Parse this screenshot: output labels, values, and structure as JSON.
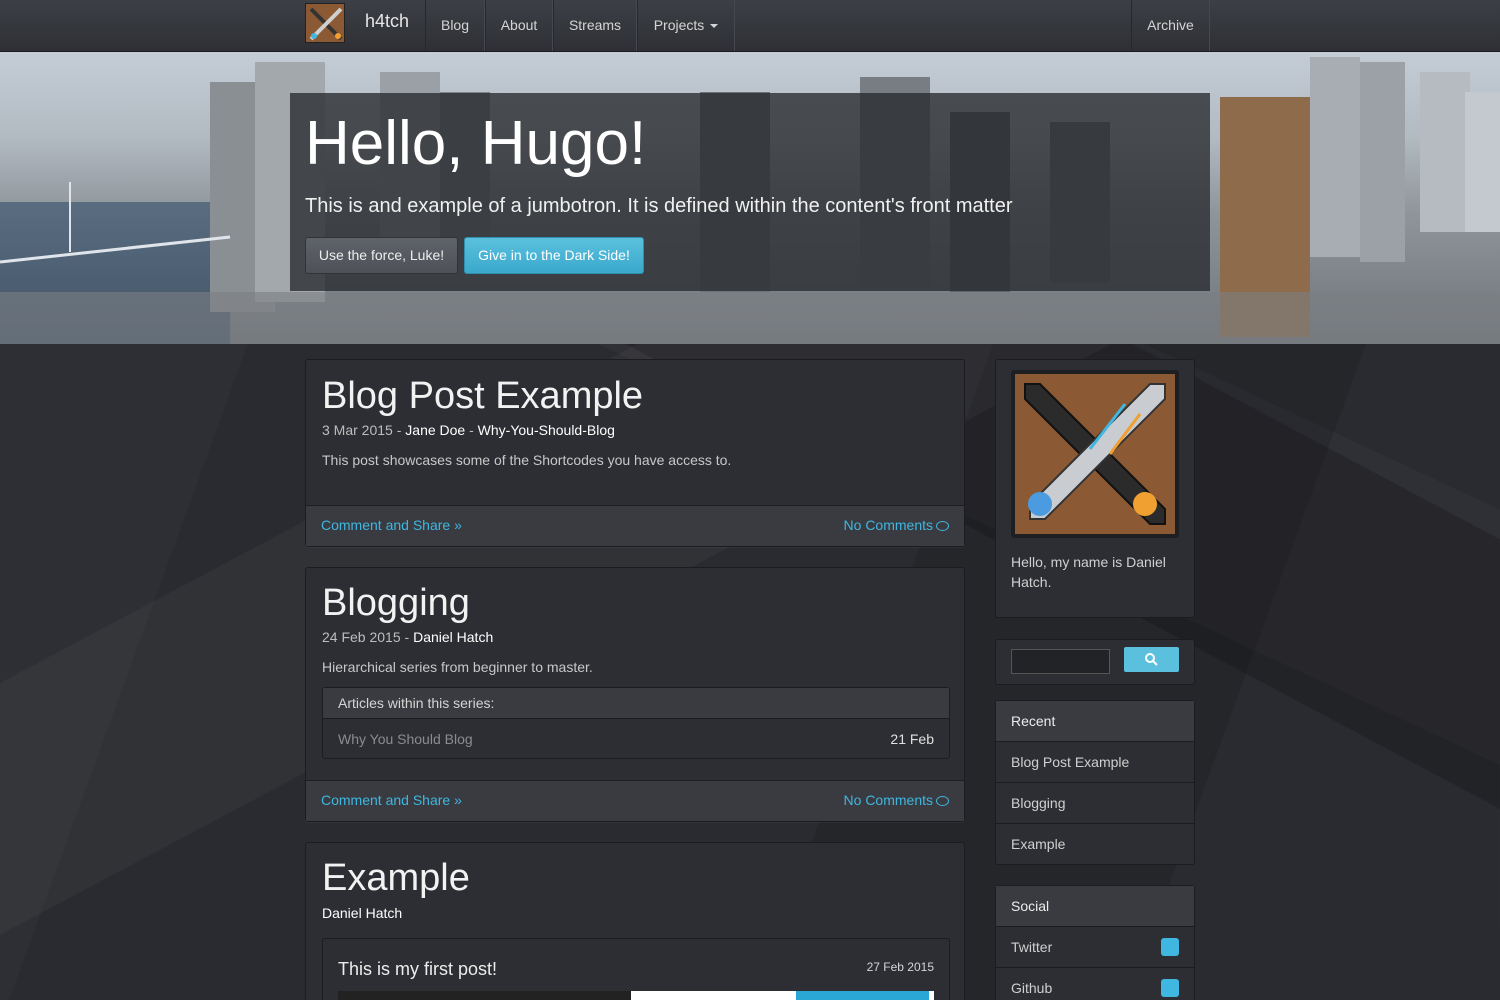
{
  "nav": {
    "brand": "h4tch",
    "items": [
      "Blog",
      "About",
      "Streams",
      "Projects"
    ],
    "right_item": "Archive"
  },
  "jumbotron": {
    "title": "Hello, Hugo!",
    "subtitle": "This is and example of a jumbotron. It is defined within the content's front matter",
    "button1": "Use the force, Luke!",
    "button2": "Give in to the Dark Side!"
  },
  "posts": [
    {
      "title": "Blog Post Example",
      "date": "3 Mar 2015",
      "author": "Jane Doe",
      "series": "Why-You-Should-Blog",
      "description": "This post showcases some of the Shortcodes you have access to.",
      "comment_link": "Comment and Share »",
      "comments": "No Comments"
    },
    {
      "title": "Blogging",
      "date": "24 Feb 2015",
      "author": "Daniel Hatch",
      "description": "Hierarchical series from beginner to master.",
      "series_box": {
        "header": "Articles within this series:",
        "item": "Why You Should Blog",
        "item_date": "21 Feb"
      },
      "comment_link": "Comment and Share »",
      "comments": "No Comments"
    },
    {
      "title": "Example",
      "author": "Daniel Hatch",
      "inner": {
        "title": "This is my first post!",
        "date": "27 Feb 2015"
      }
    }
  ],
  "sidebar": {
    "about": "Hello, my name is Daniel Hatch.",
    "recent": {
      "heading": "Recent",
      "items": [
        "Blog Post Example",
        "Blogging",
        "Example"
      ]
    },
    "social": {
      "heading": "Social",
      "items": [
        {
          "label": "Twitter",
          "icon": "twitter-icon"
        },
        {
          "label": "Github",
          "icon": "github-icon"
        }
      ]
    }
  },
  "colors": {
    "accent": "#3fb7e0",
    "info_button": "#5bc0de",
    "brand_logo": "#8b5a34"
  }
}
